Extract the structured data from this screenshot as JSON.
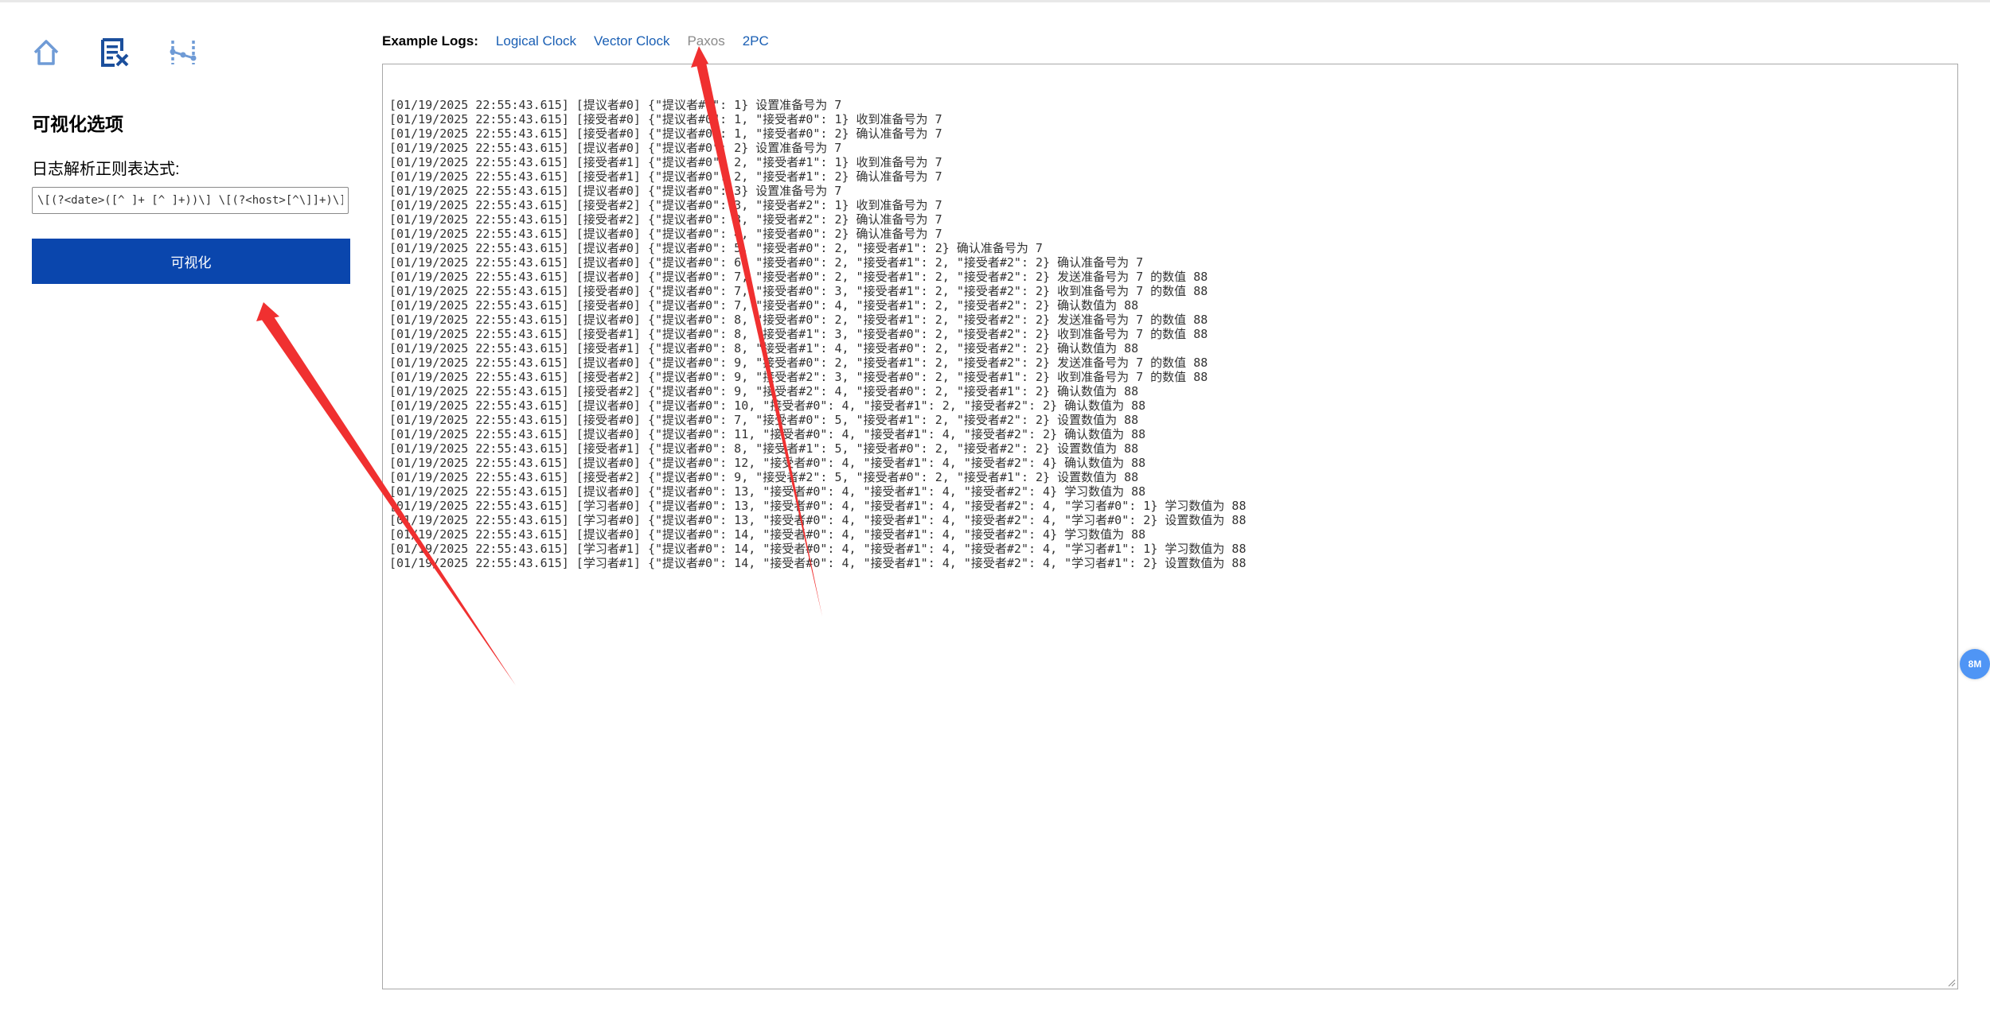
{
  "sidebar": {
    "nav_icons": [
      "home-icon",
      "document-edit-icon",
      "graph-nodes-icon"
    ],
    "title": "可视化选项",
    "regex_label": "日志解析正则表达式:",
    "regex_value": "\\[(?<date>([^ ]+ [^ ]+))\\] \\[(?<host>[^\\]]+)\\] (?<clock>{.*}) (?<event>.*)",
    "visualize_label": "可视化"
  },
  "examples": {
    "label": "Example Logs:",
    "links": [
      "Logical Clock",
      "Vector Clock",
      "Paxos",
      "2PC"
    ],
    "active": "Paxos",
    "link_color": "#1a5fb4",
    "active_color": "#8a8a8a"
  },
  "log_lines": [
    "[01/19/2025 22:55:43.615] [提议者#0] {\"提议者#0\": 1} 设置准备号为 7",
    "[01/19/2025 22:55:43.615] [接受者#0] {\"提议者#0\": 1, \"接受者#0\": 1} 收到准备号为 7",
    "[01/19/2025 22:55:43.615] [接受者#0] {\"提议者#0\": 1, \"接受者#0\": 2} 确认准备号为 7",
    "[01/19/2025 22:55:43.615] [提议者#0] {\"提议者#0\": 2} 设置准备号为 7",
    "[01/19/2025 22:55:43.615] [接受者#1] {\"提议者#0\": 2, \"接受者#1\": 1} 收到准备号为 7",
    "[01/19/2025 22:55:43.615] [接受者#1] {\"提议者#0\": 2, \"接受者#1\": 2} 确认准备号为 7",
    "[01/19/2025 22:55:43.615] [提议者#0] {\"提议者#0\": 3} 设置准备号为 7",
    "[01/19/2025 22:55:43.615] [接受者#2] {\"提议者#0\": 3, \"接受者#2\": 1} 收到准备号为 7",
    "[01/19/2025 22:55:43.615] [接受者#2] {\"提议者#0\": 3, \"接受者#2\": 2} 确认准备号为 7",
    "[01/19/2025 22:55:43.615] [提议者#0] {\"提议者#0\": 4, \"接受者#0\": 2} 确认准备号为 7",
    "[01/19/2025 22:55:43.615] [提议者#0] {\"提议者#0\": 5, \"接受者#0\": 2, \"接受者#1\": 2} 确认准备号为 7",
    "[01/19/2025 22:55:43.615] [提议者#0] {\"提议者#0\": 6, \"接受者#0\": 2, \"接受者#1\": 2, \"接受者#2\": 2} 确认准备号为 7",
    "[01/19/2025 22:55:43.615] [提议者#0] {\"提议者#0\": 7, \"接受者#0\": 2, \"接受者#1\": 2, \"接受者#2\": 2} 发送准备号为 7 的数值 88",
    "[01/19/2025 22:55:43.615] [接受者#0] {\"提议者#0\": 7, \"接受者#0\": 3, \"接受者#1\": 2, \"接受者#2\": 2} 收到准备号为 7 的数值 88",
    "[01/19/2025 22:55:43.615] [接受者#0] {\"提议者#0\": 7, \"接受者#0\": 4, \"接受者#1\": 2, \"接受者#2\": 2} 确认数值为 88",
    "[01/19/2025 22:55:43.615] [提议者#0] {\"提议者#0\": 8, \"接受者#0\": 2, \"接受者#1\": 2, \"接受者#2\": 2} 发送准备号为 7 的数值 88",
    "[01/19/2025 22:55:43.615] [接受者#1] {\"提议者#0\": 8, \"接受者#1\": 3, \"接受者#0\": 2, \"接受者#2\": 2} 收到准备号为 7 的数值 88",
    "[01/19/2025 22:55:43.615] [接受者#1] {\"提议者#0\": 8, \"接受者#1\": 4, \"接受者#0\": 2, \"接受者#2\": 2} 确认数值为 88",
    "[01/19/2025 22:55:43.615] [提议者#0] {\"提议者#0\": 9, \"接受者#0\": 2, \"接受者#1\": 2, \"接受者#2\": 2} 发送准备号为 7 的数值 88",
    "[01/19/2025 22:55:43.615] [接受者#2] {\"提议者#0\": 9, \"接受者#2\": 3, \"接受者#0\": 2, \"接受者#1\": 2} 收到准备号为 7 的数值 88",
    "[01/19/2025 22:55:43.615] [接受者#2] {\"提议者#0\": 9, \"接受者#2\": 4, \"接受者#0\": 2, \"接受者#1\": 2} 确认数值为 88",
    "[01/19/2025 22:55:43.615] [提议者#0] {\"提议者#0\": 10, \"接受者#0\": 4, \"接受者#1\": 2, \"接受者#2\": 2} 确认数值为 88",
    "[01/19/2025 22:55:43.615] [接受者#0] {\"提议者#0\": 7, \"接受者#0\": 5, \"接受者#1\": 2, \"接受者#2\": 2} 设置数值为 88",
    "[01/19/2025 22:55:43.615] [提议者#0] {\"提议者#0\": 11, \"接受者#0\": 4, \"接受者#1\": 4, \"接受者#2\": 2} 确认数值为 88",
    "[01/19/2025 22:55:43.615] [接受者#1] {\"提议者#0\": 8, \"接受者#1\": 5, \"接受者#0\": 2, \"接受者#2\": 2} 设置数值为 88",
    "[01/19/2025 22:55:43.615] [提议者#0] {\"提议者#0\": 12, \"接受者#0\": 4, \"接受者#1\": 4, \"接受者#2\": 4} 确认数值为 88",
    "[01/19/2025 22:55:43.615] [接受者#2] {\"提议者#0\": 9, \"接受者#2\": 5, \"接受者#0\": 2, \"接受者#1\": 2} 设置数值为 88",
    "[01/19/2025 22:55:43.615] [提议者#0] {\"提议者#0\": 13, \"接受者#0\": 4, \"接受者#1\": 4, \"接受者#2\": 4} 学习数值为 88",
    "[01/19/2025 22:55:43.615] [学习者#0] {\"提议者#0\": 13, \"接受者#0\": 4, \"接受者#1\": 4, \"接受者#2\": 4, \"学习者#0\": 1} 学习数值为 88",
    "[01/19/2025 22:55:43.615] [学习者#0] {\"提议者#0\": 13, \"接受者#0\": 4, \"接受者#1\": 4, \"接受者#2\": 4, \"学习者#0\": 2} 设置数值为 88",
    "[01/19/2025 22:55:43.615] [提议者#0] {\"提议者#0\": 14, \"接受者#0\": 4, \"接受者#1\": 4, \"接受者#2\": 4} 学习数值为 88",
    "[01/19/2025 22:55:43.615] [学习者#1] {\"提议者#0\": 14, \"接受者#0\": 4, \"接受者#1\": 4, \"接受者#2\": 4, \"学习者#1\": 1} 学习数值为 88",
    "[01/19/2025 22:55:43.615] [学习者#1] {\"提议者#0\": 14, \"接受者#0\": 4, \"接受者#1\": 4, \"接受者#2\": 4, \"学习者#1\": 2} 设置数值为 88"
  ],
  "float_badge": "8M",
  "colors": {
    "primary_button": "#0a46ad",
    "nav_icon_primary": "#1b4f9c",
    "nav_icon_light": "#6f9bd6",
    "badge": "#4f95f5",
    "annotation_arrow": "#f03030"
  }
}
